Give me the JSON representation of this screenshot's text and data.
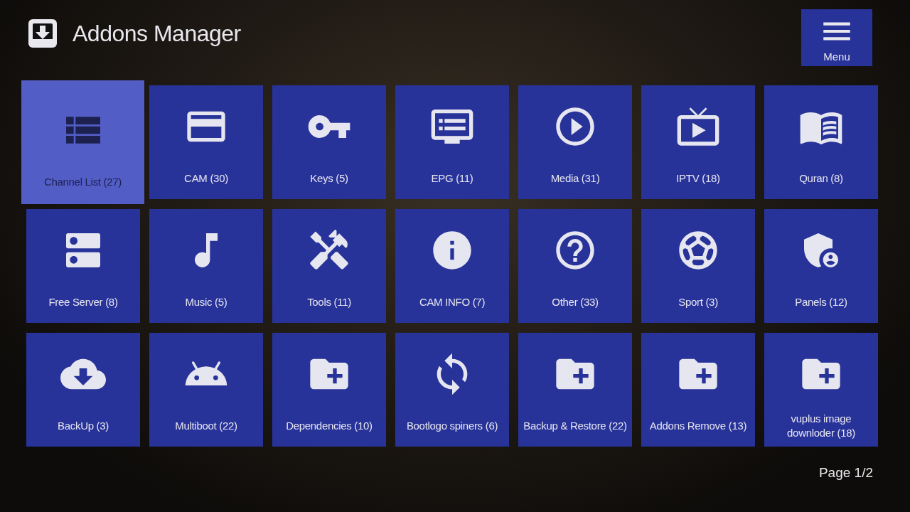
{
  "header": {
    "title": "Addons Manager"
  },
  "menu_button": {
    "label": "Menu"
  },
  "tiles": [
    {
      "kind": "list",
      "label": "Channel List (27)",
      "selected": true
    },
    {
      "kind": "card",
      "label": "CAM (30)",
      "selected": false
    },
    {
      "kind": "key",
      "label": "Keys (5)",
      "selected": false
    },
    {
      "kind": "epg",
      "label": "EPG (11)",
      "selected": false
    },
    {
      "kind": "play",
      "label": "Media (31)",
      "selected": false
    },
    {
      "kind": "tv",
      "label": "IPTV (18)",
      "selected": false
    },
    {
      "kind": "book",
      "label": "Quran (8)",
      "selected": false
    },
    {
      "kind": "server",
      "label": "Free Server (8)",
      "selected": false
    },
    {
      "kind": "music",
      "label": "Music (5)",
      "selected": false
    },
    {
      "kind": "tools",
      "label": "Tools (11)",
      "selected": false
    },
    {
      "kind": "info",
      "label": "CAM INFO (7)",
      "selected": false
    },
    {
      "kind": "help",
      "label": "Other (33)",
      "selected": false
    },
    {
      "kind": "ball",
      "label": "Sport (3)",
      "selected": false
    },
    {
      "kind": "shield",
      "label": "Panels (12)",
      "selected": false
    },
    {
      "kind": "cloud",
      "label": "BackUp (3)",
      "selected": false
    },
    {
      "kind": "android",
      "label": "Multiboot (22)",
      "selected": false
    },
    {
      "kind": "folder",
      "label": "Dependencies (10)",
      "selected": false
    },
    {
      "kind": "sync",
      "label": "Bootlogo spiners (6)",
      "selected": false
    },
    {
      "kind": "folder",
      "label": "Backup & Restore (22)",
      "selected": false
    },
    {
      "kind": "folder",
      "label": "Addons Remove (13)",
      "selected": false
    },
    {
      "kind": "folder",
      "label": "vuplus image downloder (18)",
      "selected": false
    }
  ],
  "page_indicator": "Page 1/2"
}
